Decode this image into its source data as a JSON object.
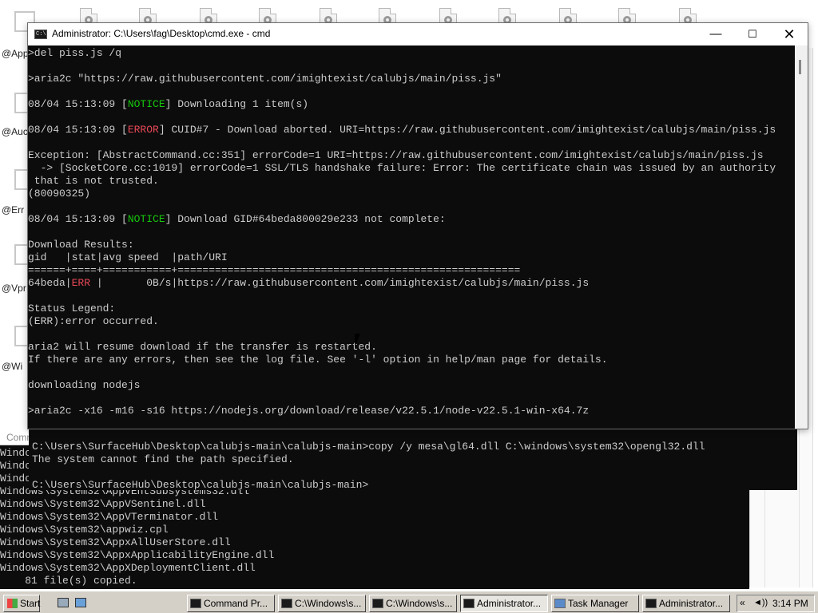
{
  "desktop": {
    "side_labels": [
      "@App",
      "@Auc",
      "@Err",
      "@Vpr",
      "@Wi"
    ]
  },
  "cmd_window": {
    "title": "Administrator: C:\\Users\\fag\\Desktop\\cmd.exe - cmd",
    "minimize_glyph": "—",
    "maximize_glyph": "☐",
    "close_glyph": "✕",
    "lines": [
      [
        {
          "t": ">del piss.js /q"
        }
      ],
      [
        {
          "t": ""
        }
      ],
      [
        {
          "t": ">aria2c \"https://raw.githubusercontent.com/imightexist/calubjs/main/piss.js\""
        }
      ],
      [
        {
          "t": ""
        }
      ],
      [
        {
          "t": "08/04 15:13:09 ["
        },
        {
          "t": "NOTICE",
          "c": "#16c60c"
        },
        {
          "t": "] Downloading 1 item(s)"
        }
      ],
      [
        {
          "t": ""
        }
      ],
      [
        {
          "t": "08/04 15:13:09 ["
        },
        {
          "t": "ERROR",
          "c": "#e74856"
        },
        {
          "t": "] CUID#7 - Download aborted. URI=https://raw.githubusercontent.com/imightexist/calubjs/main/piss.js"
        }
      ],
      [
        {
          "t": ""
        }
      ],
      [
        {
          "t": "Exception: [AbstractCommand.cc:351] errorCode=1 URI=https://raw.githubusercontent.com/imightexist/calubjs/main/piss.js"
        }
      ],
      [
        {
          "t": "  -> [SocketCore.cc:1019] errorCode=1 SSL/TLS handshake failure: Error: The certificate chain was issued by an authority"
        }
      ],
      [
        {
          "t": " that is not trusted."
        }
      ],
      [
        {
          "t": "(80090325)"
        }
      ],
      [
        {
          "t": ""
        }
      ],
      [
        {
          "t": "08/04 15:13:09 ["
        },
        {
          "t": "NOTICE",
          "c": "#16c60c"
        },
        {
          "t": "] Download GID#64beda800029e233 not complete:"
        }
      ],
      [
        {
          "t": ""
        }
      ],
      [
        {
          "t": "Download Results:"
        }
      ],
      [
        {
          "t": "gid   |stat|avg speed  |path/URI"
        }
      ],
      [
        {
          "t": "======+====+===========+======================================================="
        }
      ],
      [
        {
          "t": "64beda|"
        },
        {
          "t": "ERR ",
          "c": "#e74856"
        },
        {
          "t": "|       0B/s|https://raw.githubusercontent.com/imightexist/calubjs/main/piss.js"
        }
      ],
      [
        {
          "t": ""
        }
      ],
      [
        {
          "t": "Status Legend:"
        }
      ],
      [
        {
          "t": "(ERR):error occurred."
        }
      ],
      [
        {
          "t": ""
        }
      ],
      [
        {
          "t": "aria2 will resume download if the transfer is restarted."
        }
      ],
      [
        {
          "t": "If there are any errors, then see the log file. See '-l' option in help/man page for details."
        }
      ],
      [
        {
          "t": ""
        }
      ],
      [
        {
          "t": "downloading nodejs"
        }
      ],
      [
        {
          "t": ""
        }
      ],
      [
        {
          "t": ">aria2c -x16 -m16 -s16 https://nodejs.org/download/release/v22.5.1/node-v22.5.1-win-x64.7z"
        }
      ]
    ]
  },
  "console2": {
    "lines": [
      "C:\\Users\\SurfaceHub\\Desktop\\calubjs-main\\calubjs-main>copy /y mesa\\gl64.dll C:\\windows\\system32\\opengl32.dll",
      "The system cannot find the path specified.",
      "",
      "C:\\Users\\SurfaceHub\\Desktop\\calubjs-main\\calubjs-main>"
    ]
  },
  "bg_console": {
    "title": "Comm",
    "lines": [
      "Windo",
      "Windo",
      "Windo",
      "Windows\\System32\\AppVEntSubsystems32.dll",
      "Windows\\System32\\AppVSentinel.dll",
      "Windows\\System32\\AppVTerminator.dll",
      "Windows\\System32\\appwiz.cpl",
      "Windows\\System32\\AppxAllUserStore.dll",
      "Windows\\System32\\AppxApplicabilityEngine.dll",
      "Windows\\System32\\AppXDeploymentClient.dll",
      "    81 file(s) copied."
    ]
  },
  "taskbar": {
    "start_label": "Start",
    "buttons": [
      {
        "label": "Command Pr...",
        "icon": "console-icon",
        "active": false
      },
      {
        "label": "C:\\Windows\\s...",
        "icon": "console-icon",
        "active": false
      },
      {
        "label": "C:\\Windows\\s...",
        "icon": "console-icon",
        "active": false
      },
      {
        "label": "Administrator...",
        "icon": "console-icon",
        "active": true
      },
      {
        "label": "Task Manager",
        "icon": "task-manager-icon",
        "active": false
      },
      {
        "label": "Administrator...",
        "icon": "console-icon",
        "active": false
      }
    ],
    "tray_chevron": "«",
    "volume_glyph": "◄))",
    "clock": "3:14 PM"
  }
}
